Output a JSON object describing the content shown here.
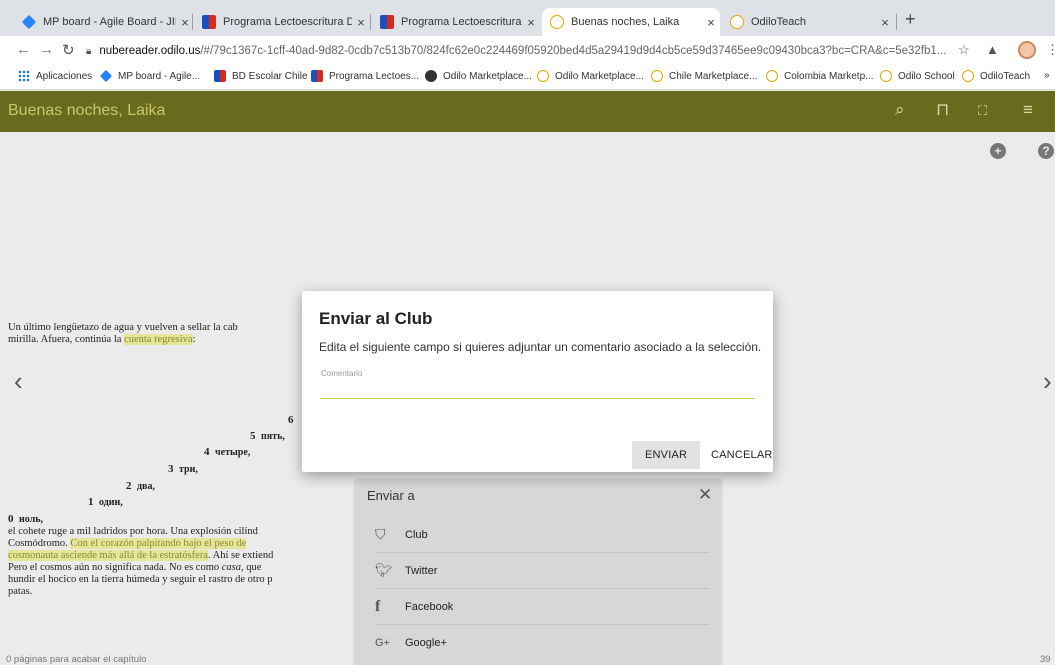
{
  "browser": {
    "tabs": [
      {
        "title": "MP board - Agile Board - JIRA",
        "icon": "jira-icon"
      },
      {
        "title": "Programa Lectoescritura Digital",
        "icon": "chile-flag-icon"
      },
      {
        "title": "Programa Lectoescritura Digital",
        "icon": "chile-flag-icon"
      },
      {
        "title": "Buenas noches, Laika",
        "icon": "odilo-icon",
        "active": true
      },
      {
        "title": "OdiloTeach",
        "icon": "odilo-icon"
      }
    ],
    "new_tab_label": "+",
    "close_glyph": "×",
    "address": {
      "host": "nubereader.odilo.us",
      "path": "/#/79c1367c-1cff-40ad-9d82-0cdb7c513b70/824fc62e0c224469f05920bed4d5a29419d9d4cb5ce59d37465ee9c09430bca3?bc=CRA&c=5e32fb1..."
    },
    "bookmarks": [
      {
        "label": "Aplicaciones",
        "icon": "apps-grid-icon"
      },
      {
        "label": "MP board - Agile...",
        "icon": "jira-icon"
      },
      {
        "label": "BD Escolar Chile",
        "icon": "chile-flag-icon"
      },
      {
        "label": "Programa Lectoes...",
        "icon": "chile-flag-icon"
      },
      {
        "label": "Odilo Marketplace...",
        "icon": "globe-icon"
      },
      {
        "label": "Odilo Marketplace...",
        "icon": "odilo-icon"
      },
      {
        "label": "Chile Marketplace...",
        "icon": "odilo-icon"
      },
      {
        "label": "Colombia Marketp...",
        "icon": "odilo-icon"
      },
      {
        "label": "Odilo School",
        "icon": "odilo-icon"
      },
      {
        "label": "OdiloTeach",
        "icon": "odilo-icon"
      }
    ],
    "bookmarks_overflow": "»"
  },
  "reader": {
    "title": "Buenas noches, Laika",
    "header_color": "#6a6a1e",
    "icons": [
      "search-icon",
      "bookmark-icon",
      "fullscreen-icon",
      "menu-icon"
    ],
    "text_intro_line1": "Un último lengüetazo de agua y vuelven a sellar la cab",
    "text_intro_line2_pre": "mirilla. Afuera, continúa la ",
    "text_intro_line2_hl": "cuenta regresiva",
    "text_intro_line2_post": ":",
    "countdown": [
      {
        "num": "6",
        "word": ""
      },
      {
        "num": "5",
        "word": "пять,"
      },
      {
        "num": "4",
        "word": "четыре,"
      },
      {
        "num": "3",
        "word": "три,"
      },
      {
        "num": "2",
        "word": "два,"
      },
      {
        "num": "1",
        "word": "один,"
      },
      {
        "num": "0",
        "word": "ноль,"
      }
    ],
    "para_line1": "el cohete ruge a mil ladridos por hora. Una explosión cilínd",
    "para_line2_pre": "Cosmódromo. ",
    "para_line2_hl": "Con el corazón palpitando bajo el peso de",
    "para_line3_hl": "cosmonauta asciende más allá de la estratósfera",
    "para_line3_post": ". Ahí se extiend",
    "para_line4_pre": "Pero el cosmos aún no significa nada. No es como ",
    "para_line4_em": "casa",
    "para_line4_post": ", que",
    "para_line5": "hundir el hocico en la tierra húmeda y seguir el rastro de otro p",
    "para_line6": "patas.",
    "footer_left": "0 páginas para acabar el capítulo",
    "footer_right": "39"
  },
  "share_panel": {
    "title": "Enviar a",
    "items": [
      {
        "label": "Club",
        "icon": "club-icon"
      },
      {
        "label": "Twitter",
        "icon": "twitter-icon"
      },
      {
        "label": "Facebook",
        "icon": "facebook-icon"
      },
      {
        "label": "Google+",
        "icon": "google-plus-icon"
      }
    ]
  },
  "dialog": {
    "title": "Enviar al Club",
    "description": "Edita el siguiente campo si quieres adjuntar un comentario asociado a la selección.",
    "field_label": "Comentario",
    "field_value": "",
    "send_label": "ENVIAR",
    "cancel_label": "CANCELAR",
    "accent_color": "#d4cd50"
  }
}
